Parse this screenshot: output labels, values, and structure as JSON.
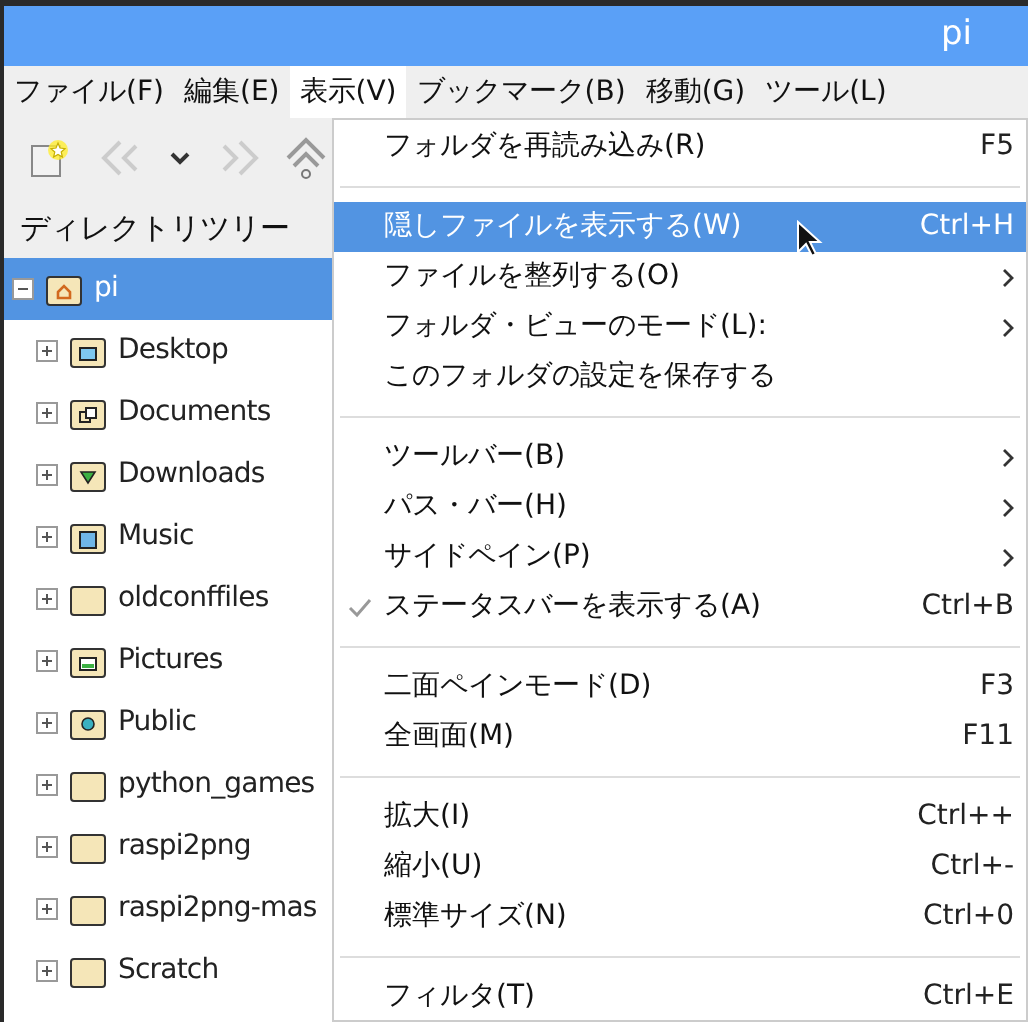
{
  "window": {
    "title": "pi"
  },
  "menubar": [
    {
      "label": "ファイル(F)",
      "selected": false
    },
    {
      "label": "編集(E)",
      "selected": false
    },
    {
      "label": "表示(V)",
      "selected": true
    },
    {
      "label": "ブックマーク(B)",
      "selected": false
    },
    {
      "label": "移動(G)",
      "selected": false
    },
    {
      "label": "ツール(L)",
      "selected": false
    }
  ],
  "sidebar": {
    "title": "ディレクトリツリー",
    "tree": [
      {
        "label": "pi",
        "kind": "home",
        "expanded": true,
        "selected": true,
        "children": [
          {
            "label": "Desktop",
            "kind": "desktop",
            "expanded": false,
            "selected": false
          },
          {
            "label": "Documents",
            "kind": "documents",
            "expanded": false,
            "selected": false
          },
          {
            "label": "Downloads",
            "kind": "downloads",
            "expanded": false,
            "selected": false
          },
          {
            "label": "Music",
            "kind": "music",
            "expanded": false,
            "selected": false
          },
          {
            "label": "oldconffiles",
            "kind": "folder",
            "expanded": false,
            "selected": false
          },
          {
            "label": "Pictures",
            "kind": "pictures",
            "expanded": false,
            "selected": false
          },
          {
            "label": "Public",
            "kind": "public",
            "expanded": false,
            "selected": false
          },
          {
            "label": "python_games",
            "kind": "folder",
            "expanded": false,
            "selected": false
          },
          {
            "label": "raspi2png",
            "kind": "folder",
            "expanded": false,
            "selected": false
          },
          {
            "label": "raspi2png-mas",
            "kind": "folder",
            "expanded": false,
            "selected": false
          },
          {
            "label": "Scratch",
            "kind": "folder",
            "expanded": false,
            "selected": false
          }
        ]
      }
    ]
  },
  "menu": [
    {
      "kind": "item",
      "label": "フォルダを再読み込み(R)",
      "shortcut": "F5",
      "submenu": false,
      "checked": false,
      "selected": false
    },
    {
      "kind": "separator"
    },
    {
      "kind": "item",
      "label": "隠しファイルを表示する(W)",
      "shortcut": "Ctrl+H",
      "submenu": false,
      "checked": false,
      "selected": true
    },
    {
      "kind": "item",
      "label": "ファイルを整列する(O)",
      "submenu": true,
      "checked": false,
      "selected": false
    },
    {
      "kind": "item",
      "label": "フォルダ・ビューのモード(L):",
      "submenu": true,
      "checked": false,
      "selected": false
    },
    {
      "kind": "item",
      "label": "このフォルダの設定を保存する",
      "submenu": false,
      "checked": false,
      "selected": false
    },
    {
      "kind": "separator"
    },
    {
      "kind": "item",
      "label": "ツールバー(B)",
      "submenu": true,
      "checked": false,
      "selected": false
    },
    {
      "kind": "item",
      "label": "パス・バー(H)",
      "submenu": true,
      "checked": false,
      "selected": false
    },
    {
      "kind": "item",
      "label": "サイドペイン(P)",
      "submenu": true,
      "checked": false,
      "selected": false
    },
    {
      "kind": "item",
      "label": "ステータスバーを表示する(A)",
      "shortcut": "Ctrl+B",
      "submenu": false,
      "checked": true,
      "selected": false
    },
    {
      "kind": "separator"
    },
    {
      "kind": "item",
      "label": "二面ペインモード(D)",
      "shortcut": "F3",
      "submenu": false,
      "checked": false,
      "selected": false
    },
    {
      "kind": "item",
      "label": "全画面(M)",
      "shortcut": "F11",
      "submenu": false,
      "checked": false,
      "selected": false
    },
    {
      "kind": "separator"
    },
    {
      "kind": "item",
      "label": "拡大(I)",
      "shortcut": "Ctrl++",
      "submenu": false,
      "checked": false,
      "selected": false
    },
    {
      "kind": "item",
      "label": "縮小(U)",
      "shortcut": "Ctrl+-",
      "submenu": false,
      "checked": false,
      "selected": false
    },
    {
      "kind": "item",
      "label": "標準サイズ(N)",
      "shortcut": "Ctrl+0",
      "submenu": false,
      "checked": false,
      "selected": false
    },
    {
      "kind": "separator"
    },
    {
      "kind": "item",
      "label": "フィルタ(T)",
      "shortcut": "Ctrl+E",
      "submenu": false,
      "checked": false,
      "selected": false
    }
  ]
}
